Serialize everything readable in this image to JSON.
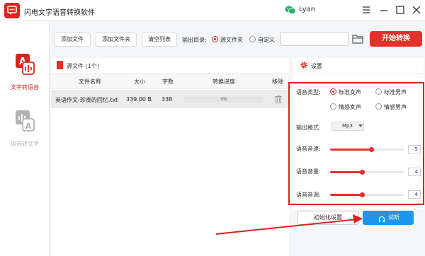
{
  "app": {
    "title": "闪电文字语音转换软件",
    "username": "Lyan"
  },
  "icons": {
    "logo": "app-logo-icon",
    "wechat": "wechat-icon",
    "window": [
      "menu-icon",
      "minimize-icon",
      "maximize-icon",
      "close-icon"
    ],
    "folder": "folder-icon",
    "trash": "trash-icon",
    "gear": "gear-icon",
    "headphone": "headphone-icon"
  },
  "colors": {
    "accent": "#d9261c",
    "start": "#e5302a",
    "listen": "#1e96f0",
    "frame": "#e02020",
    "muted": "#b3b3b3"
  },
  "sidebar": {
    "items": [
      {
        "label": "文字转语音",
        "active": true
      },
      {
        "label": "语音转文字",
        "active": false
      }
    ]
  },
  "toolbar": {
    "add_file": "添加文件",
    "add_folder": "添加文件夹",
    "clear_list": "清空列表",
    "output_dir_label": "输出目录:",
    "radio_source": "源文件夹",
    "radio_custom": "自定义",
    "output_path": "",
    "start": "开始转换"
  },
  "file_panel": {
    "title": "源文件 (1个)",
    "columns": [
      "文件名称",
      "大小",
      "字数",
      "转换进度",
      "移除"
    ],
    "rows": [
      {
        "name": "英语作文-珍贵的回忆.txt",
        "size": "339.00 B",
        "chars": "338",
        "progress_text": "0%",
        "progress": 0
      }
    ]
  },
  "settings": {
    "title": "设置",
    "voice_type_label": "语音类型:",
    "voices": [
      {
        "label": "标准女声",
        "selected": true
      },
      {
        "label": "标准男声",
        "selected": false
      },
      {
        "label": "情感女声",
        "selected": false
      },
      {
        "label": "情感男声",
        "selected": false
      }
    ],
    "format_label": "输出格式:",
    "format_value": "Mp3",
    "speed": {
      "label": "语音音速:",
      "value": "5",
      "level": 0.56
    },
    "volume": {
      "label": "语音音量:",
      "value": "4",
      "level": 0.44
    },
    "pitch": {
      "label": "语音音调:",
      "value": "4",
      "level": 0.44
    },
    "reset": "初始化设置",
    "listen": "试听"
  }
}
